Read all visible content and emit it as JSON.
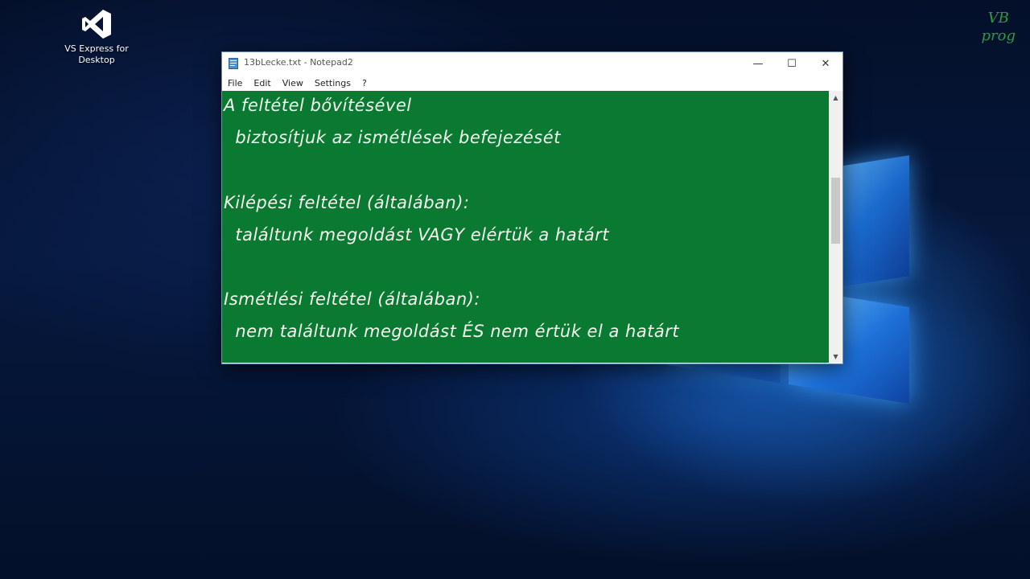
{
  "desktop": {
    "icon": {
      "name": "vs-express-icon",
      "label": "VS Express for\nDesktop"
    },
    "watermark": {
      "line1": "VB",
      "line2": "prog"
    },
    "colors": {
      "watermark": "#2e9a3e",
      "logo": "#3aa0ff"
    }
  },
  "window": {
    "title": "13bLecke.txt - Notepad2",
    "buttons": {
      "minimize": "—",
      "maximize": "☐",
      "close": "✕"
    },
    "menu": [
      "File",
      "Edit",
      "View",
      "Settings",
      "?"
    ],
    "editor": {
      "background": "#0a7a33",
      "text_color": "#f4f8ee",
      "lines": [
        "A feltétel bővítésével",
        "  biztosítjuk az ismétlések befejezését",
        "",
        "Kilépési feltétel (általában):",
        "  találtunk megoldást VAGY elértük a határt",
        "",
        "Ismétlési feltétel (általában):",
        "  nem találtunk megoldást ÉS nem értük el a határt"
      ]
    },
    "scrollbar": {
      "up": "▲",
      "down": "▼"
    }
  }
}
